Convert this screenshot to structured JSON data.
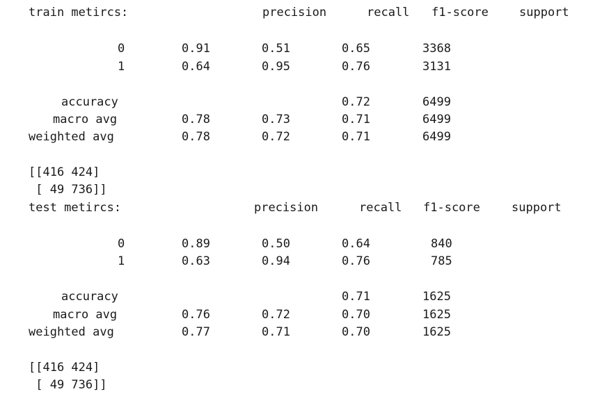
{
  "train": {
    "title": "train metircs:",
    "headers": {
      "precision": "precision",
      "recall": "recall",
      "f1": "f1-score",
      "support": "support"
    },
    "rows": {
      "class0": {
        "label": "0",
        "v1": "0.91",
        "v2": "0.51",
        "v3": "0.65",
        "v4": "3368"
      },
      "class1": {
        "label": "1",
        "v1": "0.64",
        "v2": "0.95",
        "v3": "0.76",
        "v4": "3131"
      },
      "accuracy": {
        "label": "accuracy",
        "v3": "0.72",
        "v4": "6499"
      },
      "macro": {
        "label": "macro avg",
        "v1": "0.78",
        "v2": "0.73",
        "v3": "0.71",
        "v4": "6499"
      },
      "weighted": {
        "label": "weighted avg",
        "v1": "0.78",
        "v2": "0.72",
        "v3": "0.71",
        "v4": "6499"
      }
    },
    "matrix": {
      "row1": "[[416 424]",
      "row2": " [ 49 736]]"
    }
  },
  "test": {
    "title": "test metircs:",
    "headers": {
      "precision": "precision",
      "recall": "recall",
      "f1": "f1-score",
      "support": "support"
    },
    "rows": {
      "class0": {
        "label": "0",
        "v1": "0.89",
        "v2": "0.50",
        "v3": "0.64",
        "v4": "840"
      },
      "class1": {
        "label": "1",
        "v1": "0.63",
        "v2": "0.94",
        "v3": "0.76",
        "v4": "785"
      },
      "accuracy": {
        "label": "accuracy",
        "v3": "0.71",
        "v4": "1625"
      },
      "macro": {
        "label": "macro avg",
        "v1": "0.76",
        "v2": "0.72",
        "v3": "0.70",
        "v4": "1625"
      },
      "weighted": {
        "label": "weighted avg",
        "v1": "0.77",
        "v2": "0.71",
        "v3": "0.70",
        "v4": "1625"
      }
    },
    "matrix": {
      "row1": "[[416 424]",
      "row2": " [ 49 736]]"
    }
  }
}
